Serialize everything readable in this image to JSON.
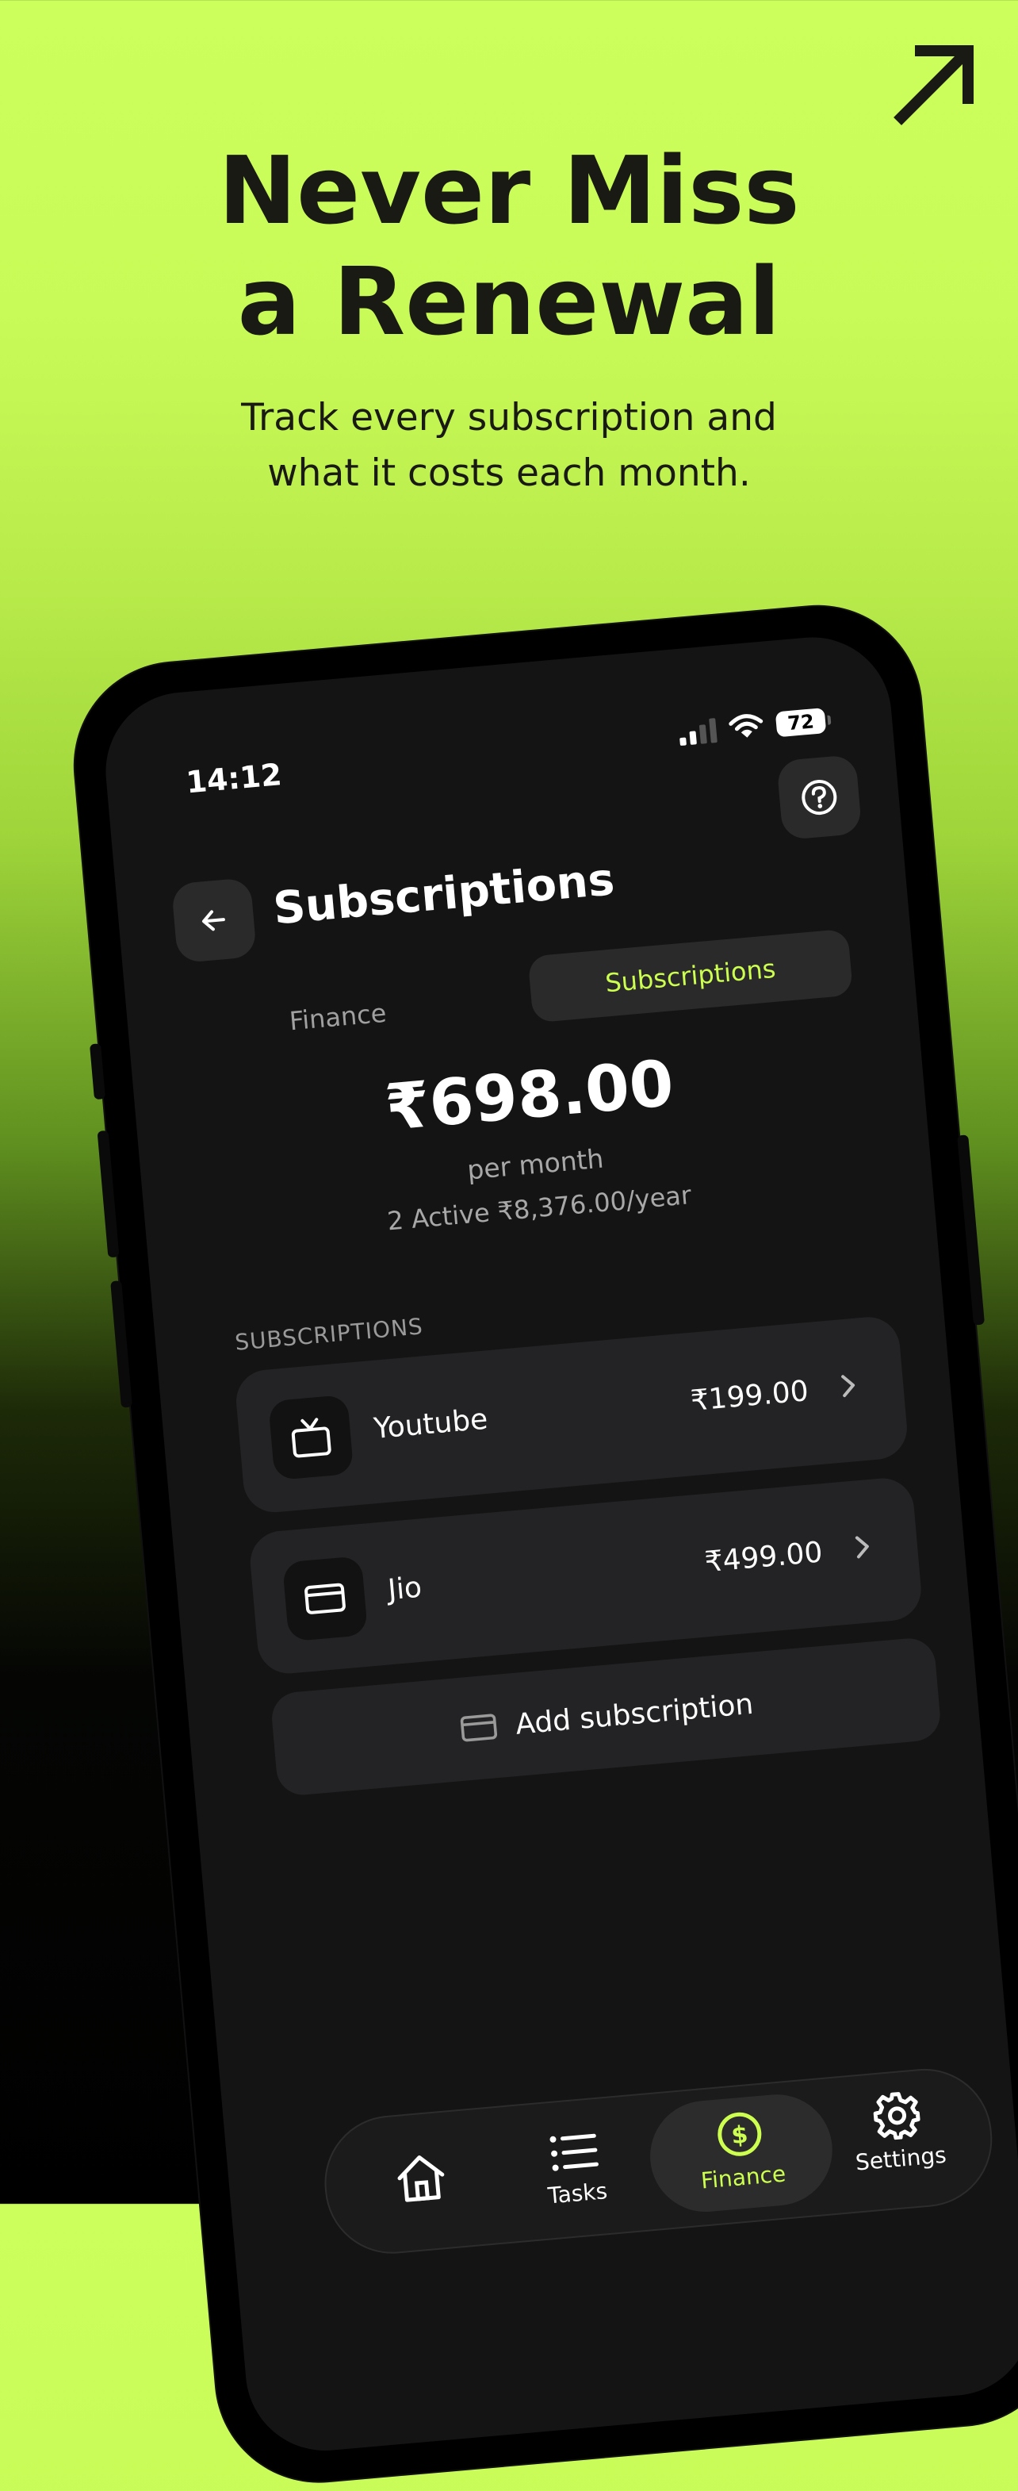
{
  "headline": {
    "line1": "Never Miss",
    "line2": "a Renewal"
  },
  "subline": {
    "line1": "Track every subscription and",
    "line2": "what it costs each month."
  },
  "colors": {
    "accent": "#ccff4f",
    "background_top": "#ccff5c",
    "screen": "#141414",
    "card": "#232325"
  },
  "status_bar": {
    "time": "14:12",
    "battery": "72"
  },
  "header": {
    "title": "Subscriptions",
    "back_icon": "arrow-left-icon",
    "help_icon": "question-circle-icon"
  },
  "tabs": [
    {
      "label": "Finance",
      "active": false
    },
    {
      "label": "Subscriptions",
      "active": true
    }
  ],
  "summary": {
    "total": "₹698.00",
    "period": "per month",
    "active_info": "2 Active ₹8,376.00/year"
  },
  "section_label": "SUBSCRIPTIONS",
  "subscriptions": [
    {
      "name": "Youtube",
      "price": "₹199.00",
      "icon": "tv-icon"
    },
    {
      "name": "Jio",
      "price": "₹499.00",
      "icon": "credit-card-icon"
    }
  ],
  "add_button": {
    "label": "Add subscription",
    "icon": "credit-card-icon"
  },
  "bottom_nav": [
    {
      "label": "",
      "icon": "home-icon",
      "active": false
    },
    {
      "label": "Tasks",
      "icon": "list-icon",
      "active": false
    },
    {
      "label": "Finance",
      "icon": "dollar-circle-icon",
      "active": true
    },
    {
      "label": "Settings",
      "icon": "gear-icon",
      "active": false
    }
  ]
}
